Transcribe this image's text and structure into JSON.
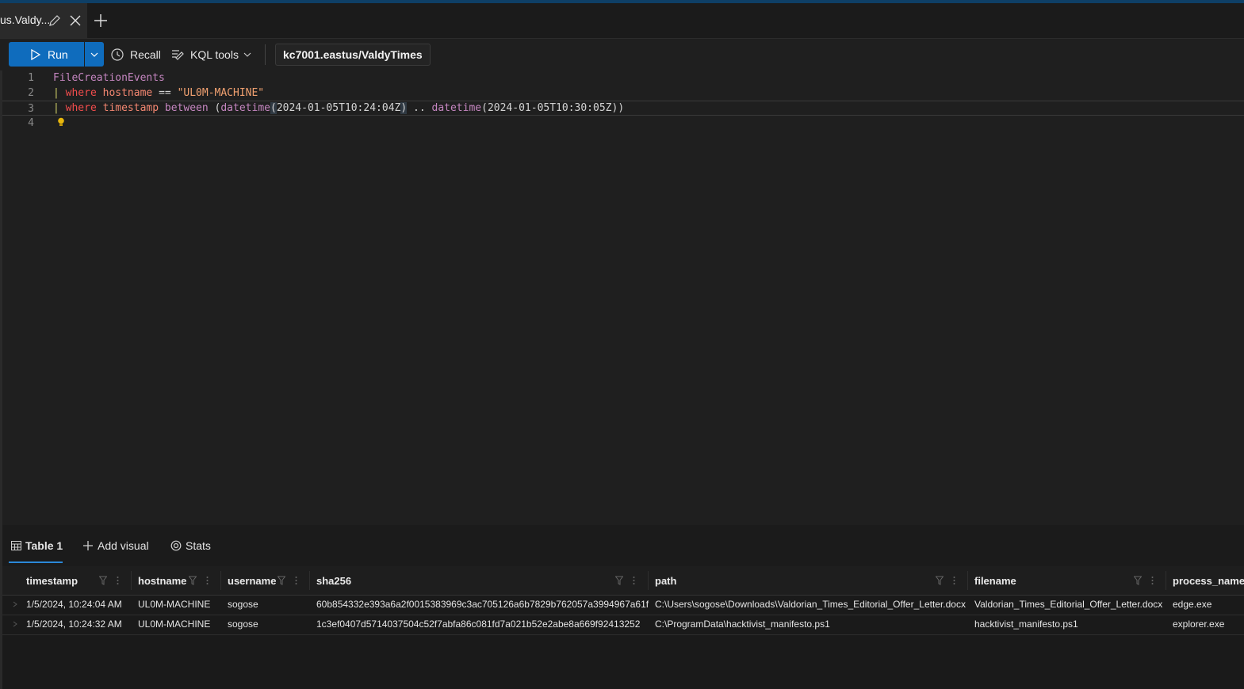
{
  "tab": {
    "title": "us.Valdy...",
    "edit_icon": "pencil-icon",
    "close_icon": "close-icon",
    "add_icon": "plus-icon"
  },
  "toolbar": {
    "run_label": "Run",
    "recall_label": "Recall",
    "kql_tools_label": "KQL tools",
    "cluster_label": "kc7001.eastus/ValdyTimes"
  },
  "editor": {
    "line_numbers": [
      "1",
      "2",
      "3",
      "4"
    ],
    "line1": {
      "table": "FileCreationEvents"
    },
    "line2": {
      "pipe": "|",
      "op": "where",
      "col": "hostname",
      "eq": "==",
      "str": "\"UL0M-MACHINE\""
    },
    "line3": {
      "pipe": "|",
      "op": "where",
      "col": "timestamp",
      "between": "between",
      "open": "(",
      "fn1": "datetime",
      "p1": "(",
      "arg1": "2024-01-05T10:24:04Z",
      "c1": ")",
      "range": " .. ",
      "fn2": "datetime",
      "p2": "(",
      "arg2": "2024-01-05T10:30:05Z",
      "c2": "))"
    }
  },
  "results": {
    "tabs": {
      "table": "Table 1",
      "add_visual": "Add visual",
      "stats": "Stats"
    },
    "columns": [
      "timestamp",
      "hostname",
      "username",
      "sha256",
      "path",
      "filename",
      "process_name"
    ],
    "rows": [
      [
        "1/5/2024, 10:24:04 AM",
        "UL0M-MACHINE",
        "sogose",
        "60b854332e393a6a2f0015383969c3ac705126a6b7829b762057a3994967a61f",
        "C:\\Users\\sogose\\Downloads\\Valdorian_Times_Editorial_Offer_Letter.docx",
        "Valdorian_Times_Editorial_Offer_Letter.docx",
        "edge.exe"
      ],
      [
        "1/5/2024, 10:24:32 AM",
        "UL0M-MACHINE",
        "sogose",
        "1c3ef0407d5714037504c52f7abfa86c081fd7a021b52e2abe8a669f92413252",
        "C:\\ProgramData\\hacktivist_manifesto.ps1",
        "hacktivist_manifesto.ps1",
        "explorer.exe"
      ]
    ]
  },
  "colors": {
    "accent": "#0f6cbd",
    "background": "#1f1f1f",
    "keyword": "#f14c4c",
    "function": "#c586c0"
  }
}
